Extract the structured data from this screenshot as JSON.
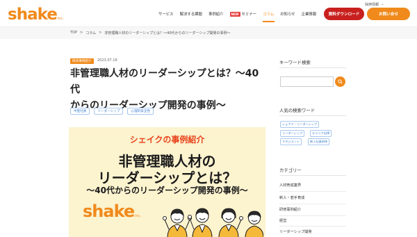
{
  "utility": {
    "recruit_label": "採用情報",
    "caret": "⌄"
  },
  "logo": {
    "text": "shake",
    "suffix": "inc."
  },
  "nav": {
    "items": [
      "サービス",
      "解決する課題",
      "事例紹介",
      "セミナー",
      "コラム",
      "お知らせ",
      "企業情報"
    ],
    "new_badge": "NEW"
  },
  "header_buttons": {
    "download": "資料ダウンロード",
    "contact": "お問い合せ"
  },
  "breadcrumb": [
    "TOP",
    ">",
    "コラム",
    ">",
    "非管理職人材のリーダーシップとは？〜40代からのリーダーシップ開発の事例〜"
  ],
  "article": {
    "category": "研修事例紹介",
    "date": "2023.07.18",
    "title_line1": "非管理職人材のリーダーシップとは？〜40代",
    "title_line2": "からのリーダーシップ開発の事例〜",
    "tags": [
      "中堅社員",
      "リーダーシップ",
      "心理的安全性"
    ]
  },
  "hero": {
    "sub": "シェイクの事例紹介",
    "line1": "非管理職人材の",
    "line2": "リーダーシップとは？",
    "line3": "〜40代からのリーダーシップ開発の事例〜",
    "logo_text": "shake",
    "logo_suffix": "inc."
  },
  "sidebar": {
    "keyword_heading": "キーワード検索",
    "search_value": "",
    "popular_heading": "人気の検索ワード",
    "popular_tags": [
      "シェアド・リーダーシップ",
      "リーダーシップ",
      "キャリア自律",
      "マネジメント",
      "新入社員研修"
    ],
    "category_heading": "カテゴリー",
    "categories": [
      "人材育成業界",
      "新人・若手育成",
      "研修事例紹介",
      "経営",
      "リーダーシップ開発"
    ]
  },
  "colors": {
    "accent": "#f08a1c",
    "download_red": "#c8201e",
    "tag_blue": "#3b7fd1",
    "hero_bg": "#fcf3cf",
    "hero_sub": "#e8431c"
  },
  "icons": {
    "search": "search-icon",
    "caret": "chevron-down-icon"
  }
}
